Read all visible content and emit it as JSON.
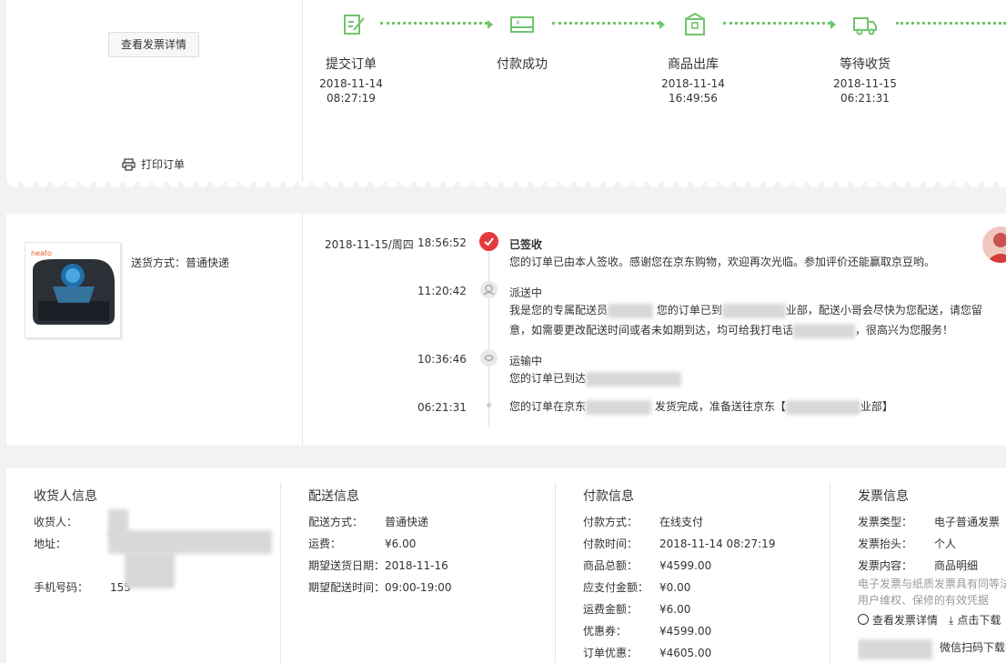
{
  "order_actions": {
    "invoice_detail_label": "查看发票详情",
    "print_label": "打印订单"
  },
  "progress": {
    "steps": [
      {
        "name": "提交订单",
        "date": "2018-11-14",
        "time": "08:27:19",
        "icon": "pencil-doc-icon"
      },
      {
        "name": "付款成功",
        "date": "",
        "time": "",
        "icon": "payment-card-icon"
      },
      {
        "name": "商品出库",
        "date": "2018-11-14",
        "time": "16:49:56",
        "icon": "package-icon"
      },
      {
        "name": "等待收货",
        "date": "2018-11-15",
        "time": "06:21:31",
        "icon": "truck-icon"
      }
    ],
    "accent": "#6ec56b"
  },
  "tracking": {
    "delivery_method": "送货方式：普通快递",
    "entries": [
      {
        "date": "2018-11-15/周四",
        "time": "18:56:52",
        "title": "已签收",
        "text": "您的订单已由本人签收。感谢您在京东购物，欢迎再次光临。参加评价还能赢取京豆哟。"
      },
      {
        "date": "",
        "time": "11:20:42",
        "title": "派送中",
        "text_a": "我是您的专属配送员",
        "text_b": "您的订单已到",
        "text_c": "业部，配送小哥会尽快为您配送，请您留",
        "text_d": "意，如需要更改配送时间或者未如期到达，均可给我打电话",
        "text_e": "，很高兴为您服务！"
      },
      {
        "date": "",
        "time": "10:36:46",
        "title": "运输中",
        "text": "您的订单已到达"
      },
      {
        "date": "",
        "time": "06:21:31",
        "title": "",
        "text_a": "您的订单在京东",
        "text_b": "发货完成，准备送往京东【",
        "text_c": "业部】"
      }
    ],
    "signed_color": "#e4393c"
  },
  "receiver": {
    "heading": "收货人信息",
    "name_label": "收货人：",
    "address_label": "地址：",
    "phone_label": "手机号码：",
    "phone_value": "155"
  },
  "shipping": {
    "heading": "配送信息",
    "rows": [
      {
        "k": "配送方式：",
        "v": "普通快递"
      },
      {
        "k": "运费：",
        "v": "¥6.00"
      },
      {
        "k": "期望送货日期：",
        "v": "2018-11-16"
      },
      {
        "k": "期望配送时间：",
        "v": "09:00-19:00"
      }
    ]
  },
  "payment": {
    "heading": "付款信息",
    "rows": [
      {
        "k": "付款方式：",
        "v": "在线支付"
      },
      {
        "k": "付款时间：",
        "v": "2018-11-14 08:27:19"
      },
      {
        "k": "商品总额：",
        "v": "¥4599.00"
      },
      {
        "k": "应支付金额：",
        "v": "¥0.00"
      },
      {
        "k": "运费金额：",
        "v": "¥6.00"
      },
      {
        "k": "优惠券：",
        "v": "¥4599.00"
      },
      {
        "k": "订单优惠：",
        "v": "¥4605.00"
      }
    ]
  },
  "invoice": {
    "heading": "发票信息",
    "rows": [
      {
        "k": "发票类型：",
        "v": "电子普通发票"
      },
      {
        "k": "发票抬头：",
        "v": "个人"
      },
      {
        "k": "发票内容：",
        "v": "商品明细"
      }
    ],
    "note_1": "电子发票与纸质发票具有同等法",
    "note_2": "用户维权、保修的有效凭据",
    "view_label": "查看发票详情",
    "download_label": "点击下载",
    "wechat_label": "微信扫码下载"
  }
}
